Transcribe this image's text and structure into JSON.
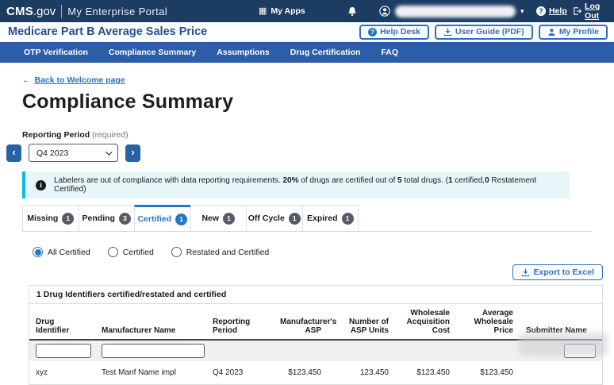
{
  "colors": {
    "topbar_navy": "#1c3c62",
    "nav_blue": "#2b5ea7",
    "accent_blue": "#2378c3",
    "link_blue": "#2a70c2",
    "banner_bg": "#e7f6f8",
    "banner_bar": "#00bde3",
    "badge_gray": "#565c65"
  },
  "icons": {
    "my_apps_grid": "▦",
    "caret_down": "▾",
    "question_mark": "?",
    "info": "i",
    "back_arrow": "←",
    "chevron_left": "‹",
    "chevron_right": "›"
  },
  "topbar": {
    "brand_cms": "CMS",
    "brand_gov": ".gov",
    "portal": "My Enterprise Portal",
    "my_apps": "My Apps",
    "help": "Help",
    "logout": "Log Out"
  },
  "appbar": {
    "title": "Medicare Part B Average Sales Price",
    "help_desk": "Help Desk",
    "user_guide": "User Guide (PDF)",
    "my_profile": "My Profile"
  },
  "nav": {
    "items": [
      "OTP Verification",
      "Compliance Summary",
      "Assumptions",
      "Drug Certification",
      "FAQ"
    ]
  },
  "page": {
    "back_link": "Back to Welcome page",
    "title": "Compliance Summary",
    "reporting_period": {
      "label": "Reporting Period",
      "required_note": " (required)",
      "value": "Q4 2023"
    },
    "banner": {
      "p1": "Labelers are out of compliance with data reporting requirements. ",
      "b1": "20%",
      "p2": " of drugs are certified out of ",
      "b2": "5",
      "p3": " total drugs. (",
      "b3": "1",
      "p4": " certified,",
      "b4": "0",
      "p5": " Restatement Certified)"
    },
    "tabs": [
      {
        "label": "Missing",
        "count": "1"
      },
      {
        "label": "Pending",
        "count": "3"
      },
      {
        "label": "Certified",
        "count": "1"
      },
      {
        "label": "New",
        "count": "1"
      },
      {
        "label": "Off Cycle",
        "count": "1"
      },
      {
        "label": "Expired",
        "count": "1"
      }
    ],
    "radios": [
      {
        "label": "All Certified"
      },
      {
        "label": "Certified"
      },
      {
        "label": "Restated and Certified"
      }
    ],
    "export_button": "Export to Excel",
    "table": {
      "caption": "1 Drug Identifiers certified/restated and certified",
      "columns": [
        "Drug Identifier",
        "Manufacturer Name",
        "Reporting Period",
        "Manufacturer's ASP",
        "Number of ASP Units",
        "Wholesale Acquisition Cost",
        "Average Wholesale Price",
        "Submitter Name"
      ],
      "rows": [
        [
          "xyz",
          "Test Manf Name impl",
          "Q4 2023",
          "$123.450",
          "123.450",
          "$123.450",
          "$123.450",
          ""
        ]
      ]
    }
  }
}
